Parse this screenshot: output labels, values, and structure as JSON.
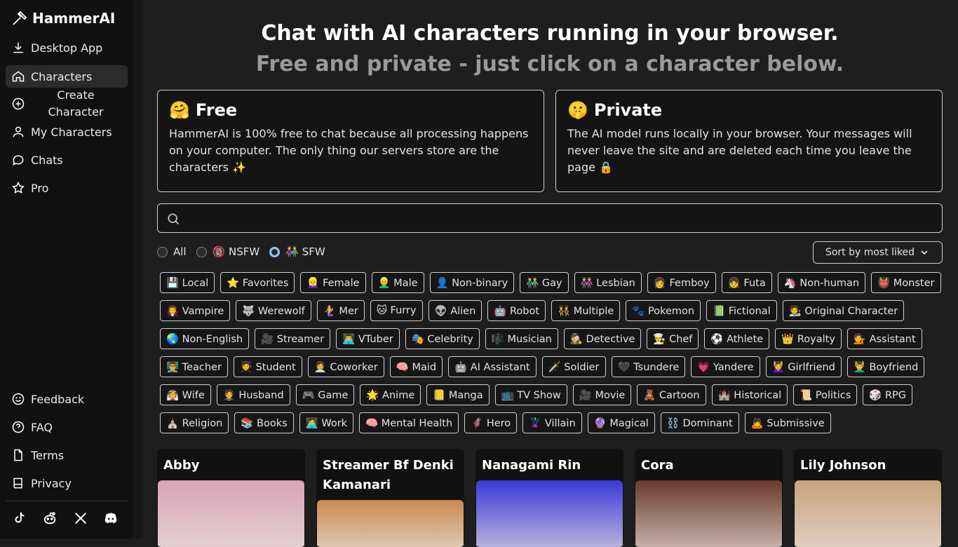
{
  "app": {
    "name": "HammerAI"
  },
  "sidebar": {
    "items": [
      {
        "label": "Desktop App",
        "icon": "download-icon"
      },
      {
        "label": "Characters",
        "icon": "home-icon",
        "active": true
      },
      {
        "label": "Create Character",
        "icon": "plus-circle-icon"
      },
      {
        "label": "My Characters",
        "icon": "user-icon"
      },
      {
        "label": "Chats",
        "icon": "chat-bubble-icon"
      },
      {
        "label": "Pro",
        "icon": "star-icon"
      }
    ],
    "bottom_items": [
      {
        "label": "Feedback",
        "icon": "smiley-icon"
      },
      {
        "label": "FAQ",
        "icon": "question-circle-icon"
      },
      {
        "label": "Terms",
        "icon": "document-icon"
      },
      {
        "label": "Privacy",
        "icon": "book-icon"
      }
    ],
    "social": [
      "tiktok-icon",
      "reddit-icon",
      "x-icon",
      "discord-icon"
    ]
  },
  "hero": {
    "title": "Chat with AI characters running in your browser.",
    "subtitle": "Free and private - just click on a character below."
  },
  "cards": [
    {
      "emoji": "🤗",
      "title": "Free",
      "body": "HammerAI is 100% free to chat because all processing happens on your computer. The only thing our servers store are the characters ✨"
    },
    {
      "emoji": "🤫",
      "title": "Private",
      "body": "The AI model runs locally in your browser. Your messages will never leave the site and are deleted each time you leave the page 🔒"
    }
  ],
  "search": {
    "placeholder": ""
  },
  "filters": [
    {
      "label": "All",
      "selected": false
    },
    {
      "label": "🔞 NSFW",
      "selected": false
    },
    {
      "label": "👫 SFW",
      "selected": true
    }
  ],
  "sort": {
    "label": "Sort by most liked"
  },
  "tags": [
    "💾 Local",
    "⭐ Favorites",
    "👱‍♀️ Female",
    "👱‍♂️ Male",
    "👤 Non-binary",
    "👬 Gay",
    "👭 Lesbian",
    "👩 Femboy",
    "👧 Futa",
    "🦄 Non-human",
    "👹 Monster",
    "🧛 Vampire",
    "🐺 Werewolf",
    "🧜‍♀️ Mer",
    "🐱 Furry",
    "👽 Alien",
    "🤖 Robot",
    "👯 Multiple",
    "🐾 Pokemon",
    "📗 Fictional",
    "🧑‍🎨 Original Character",
    "🌏 Non-English",
    "🎥 Streamer",
    "👨‍💻 VTuber",
    "🎭 Celebrity",
    "🎼 Musician",
    "🕵️ Detective",
    "👨‍🍳 Chef",
    "⚽ Athlete",
    "👑 Royalty",
    "💁 Assistant",
    "👨‍🏫 Teacher",
    "🧑‍🎓 Student",
    "👩‍💼 Coworker",
    "🧠 Maid",
    "🤖 AI Assistant",
    "🗡️ Soldier",
    "🖤 Tsundere",
    "💗 Yandere",
    "💆‍♀️ Girlfriend",
    "💆‍♂️ Boyfriend",
    "👰 Wife",
    "🤵 Husband",
    "🎮 Game",
    "🌟 Anime",
    "📒 Manga",
    "📺 TV Show",
    "🎥 Movie",
    "🧸 Cartoon",
    "🏰 Historical",
    "📜 Politics",
    "🎲 RPG",
    "⛪ Religion",
    "📚 Books",
    "👩‍💻 Work",
    "🧠 Mental Health",
    "🦸 Hero",
    "🦹 Villain",
    "🔮 Magical",
    "⛓️ Dominant",
    "🙇 Submissive"
  ],
  "characters": [
    {
      "name": "Abby",
      "color": "#d9a3b6"
    },
    {
      "name": "Streamer Bf Denki Kamanari",
      "color": "#c98a4d"
    },
    {
      "name": "Nanagami Rin",
      "color": "#3a3ad8"
    },
    {
      "name": "Cora",
      "color": "#6b3a2a"
    },
    {
      "name": "Lily Johnson",
      "color": "#c9a27a"
    }
  ]
}
